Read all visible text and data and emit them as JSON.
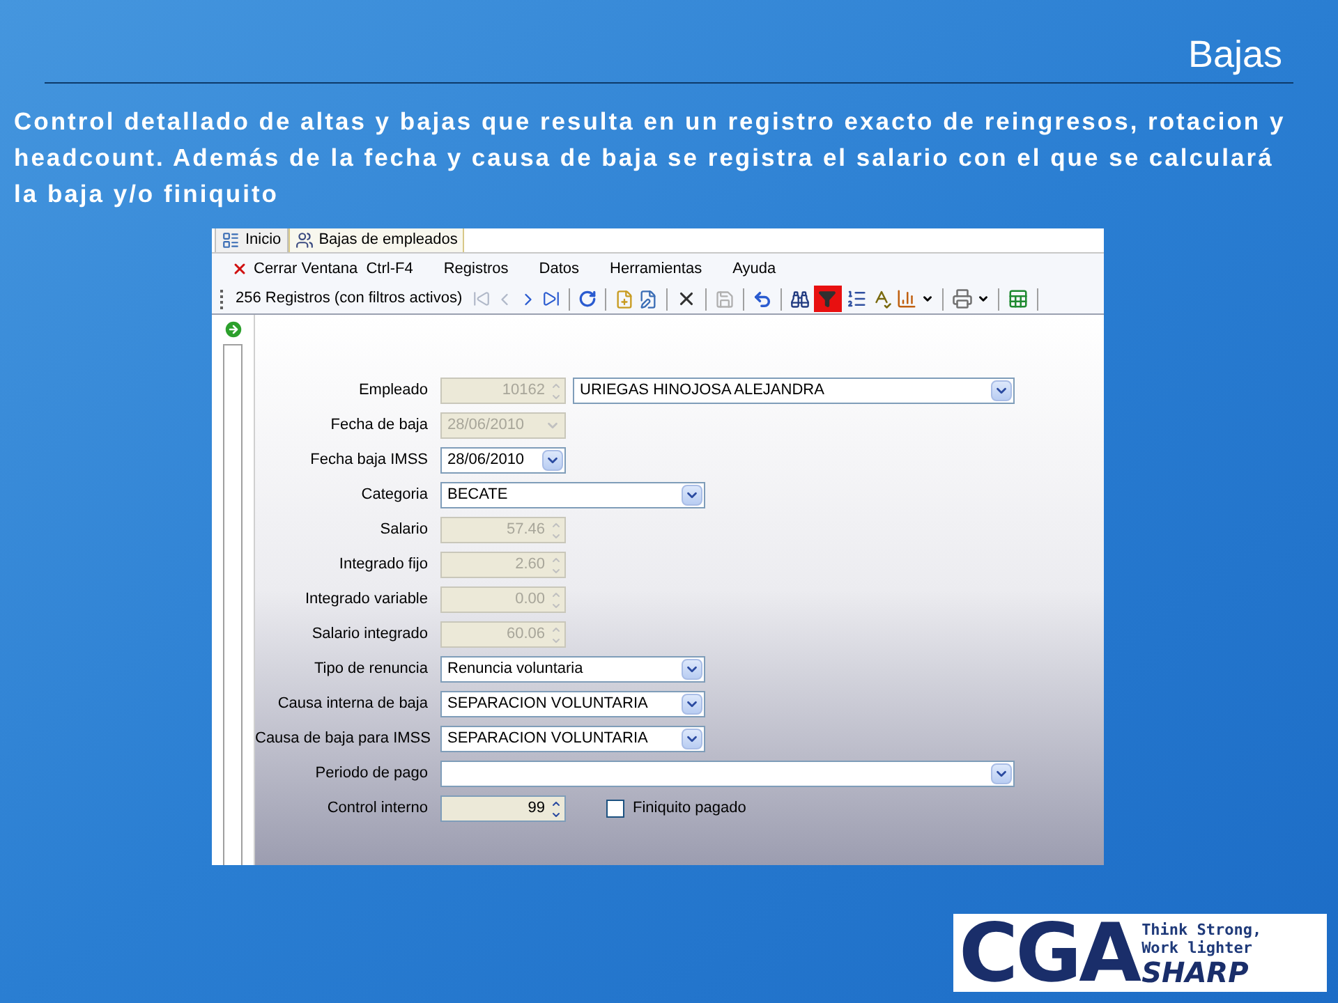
{
  "slide": {
    "title": "Bajas",
    "text": "Control detallado de altas y bajas que resulta en un registro exacto de reingresos, rotacion y headcount. Además de la fecha y causa de baja se registra el salario con el que se calculará la baja y/o finiquito"
  },
  "window": {
    "tabs": [
      {
        "label": "Inicio",
        "selected": false
      },
      {
        "label": "Bajas de empleados",
        "selected": true
      }
    ],
    "menu": [
      {
        "label": "Cerrar Ventana  Ctrl-F4",
        "kind": "close"
      },
      {
        "label": "Registros",
        "kind": "plain"
      },
      {
        "label": "Datos",
        "kind": "plain"
      },
      {
        "label": "Herramientas",
        "kind": "plain"
      },
      {
        "label": "Ayuda",
        "kind": "plain"
      }
    ],
    "toolbar": {
      "records": "256 Registros (con filtros activos)",
      "filter_on": true
    },
    "form": [
      {
        "label": "Empleado",
        "controls": [
          {
            "kind": "spin",
            "value": "10162",
            "disabled": true
          },
          {
            "kind": "combo_long",
            "value": "URIEGAS HINOJOSA ALEJANDRA",
            "disabled": false
          }
        ]
      },
      {
        "label": "Fecha de baja",
        "controls": [
          {
            "kind": "date",
            "value": "28/06/2010",
            "disabled": true
          }
        ]
      },
      {
        "label": "Fecha baja IMSS",
        "controls": [
          {
            "kind": "date",
            "value": "28/06/2010",
            "disabled": false
          }
        ]
      },
      {
        "label": "Categoria",
        "controls": [
          {
            "kind": "combo",
            "value": "BECATE",
            "disabled": false
          }
        ]
      },
      {
        "label": "Salario",
        "controls": [
          {
            "kind": "spin",
            "value": "57.46",
            "disabled": true
          }
        ]
      },
      {
        "label": "Integrado fijo",
        "controls": [
          {
            "kind": "spin",
            "value": "2.60",
            "disabled": true
          }
        ]
      },
      {
        "label": "Integrado variable",
        "controls": [
          {
            "kind": "spin",
            "value": "0.00",
            "disabled": true
          }
        ]
      },
      {
        "label": "Salario integrado",
        "controls": [
          {
            "kind": "spin",
            "value": "60.06",
            "disabled": true
          }
        ]
      },
      {
        "label": "Tipo de renuncia",
        "controls": [
          {
            "kind": "combo",
            "value": "Renuncia voluntaria",
            "disabled": false
          }
        ]
      },
      {
        "label": "Causa interna de baja",
        "controls": [
          {
            "kind": "combo",
            "value": "SEPARACION VOLUNTARIA",
            "disabled": false
          }
        ]
      },
      {
        "label": "Causa de baja para IMSS",
        "controls": [
          {
            "kind": "combo",
            "value": "SEPARACION VOLUNTARIA",
            "disabled": false
          }
        ]
      },
      {
        "label": "Periodo de pago",
        "controls": [
          {
            "kind": "combo_long",
            "disabled": false
          }
        ]
      },
      {
        "label": "Control interno",
        "controls": [
          {
            "kind": "spin",
            "value": "99",
            "disabled": false
          },
          {
            "kind": "checkbox",
            "label": "Finiquito pagado",
            "checked": false
          }
        ]
      }
    ]
  },
  "logo": {
    "brand": "CGA",
    "sub": "SHARP",
    "tagline": [
      "Think Strong,",
      "Work lighter"
    ]
  }
}
